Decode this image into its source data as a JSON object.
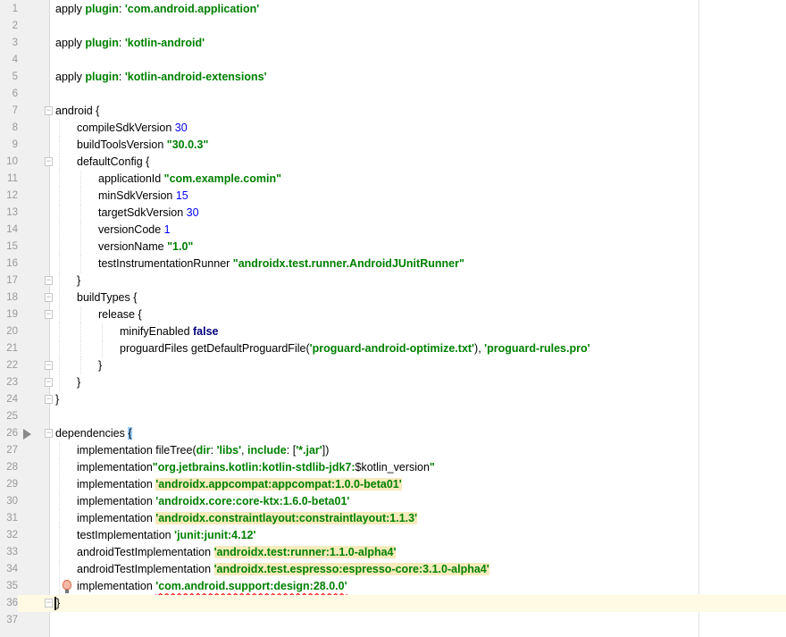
{
  "editor": {
    "current_line": 36,
    "lines": [
      {
        "n": "1",
        "indent": 0,
        "tokens": [
          {
            "t": "apply ",
            "c": "plain"
          },
          {
            "t": "plugin",
            "c": "named"
          },
          {
            "t": ": ",
            "c": "plain"
          },
          {
            "t": "'com.android.application'",
            "c": "str"
          }
        ]
      },
      {
        "n": "2",
        "indent": 0,
        "tokens": []
      },
      {
        "n": "3",
        "indent": 0,
        "tokens": [
          {
            "t": "apply ",
            "c": "plain"
          },
          {
            "t": "plugin",
            "c": "named"
          },
          {
            "t": ": ",
            "c": "plain"
          },
          {
            "t": "'kotlin-android'",
            "c": "str"
          }
        ]
      },
      {
        "n": "4",
        "indent": 0,
        "tokens": []
      },
      {
        "n": "5",
        "indent": 0,
        "tokens": [
          {
            "t": "apply ",
            "c": "plain"
          },
          {
            "t": "plugin",
            "c": "named"
          },
          {
            "t": ": ",
            "c": "plain"
          },
          {
            "t": "'kotlin-android-extensions'",
            "c": "str"
          }
        ]
      },
      {
        "n": "6",
        "indent": 0,
        "tokens": []
      },
      {
        "n": "7",
        "indent": 0,
        "fold": true,
        "tokens": [
          {
            "t": "android {",
            "c": "plain"
          }
        ]
      },
      {
        "n": "8",
        "indent": 1,
        "tokens": [
          {
            "t": "compileSdkVersion ",
            "c": "plain"
          },
          {
            "t": "30",
            "c": "num"
          }
        ]
      },
      {
        "n": "9",
        "indent": 1,
        "tokens": [
          {
            "t": "buildToolsVersion ",
            "c": "plain"
          },
          {
            "t": "\"30.0.3\"",
            "c": "str"
          }
        ]
      },
      {
        "n": "10",
        "indent": 1,
        "fold": true,
        "tokens": [
          {
            "t": "defaultConfig {",
            "c": "plain"
          }
        ]
      },
      {
        "n": "11",
        "indent": 2,
        "tokens": [
          {
            "t": "applicationId ",
            "c": "plain"
          },
          {
            "t": "\"com.example.comin\"",
            "c": "str"
          }
        ]
      },
      {
        "n": "12",
        "indent": 2,
        "tokens": [
          {
            "t": "minSdkVersion ",
            "c": "plain"
          },
          {
            "t": "15",
            "c": "num"
          }
        ]
      },
      {
        "n": "13",
        "indent": 2,
        "tokens": [
          {
            "t": "targetSdkVersion ",
            "c": "plain"
          },
          {
            "t": "30",
            "c": "num"
          }
        ]
      },
      {
        "n": "14",
        "indent": 2,
        "tokens": [
          {
            "t": "versionCode ",
            "c": "plain"
          },
          {
            "t": "1",
            "c": "num"
          }
        ]
      },
      {
        "n": "15",
        "indent": 2,
        "tokens": [
          {
            "t": "versionName ",
            "c": "plain"
          },
          {
            "t": "\"1.0\"",
            "c": "str"
          }
        ]
      },
      {
        "n": "16",
        "indent": 2,
        "tokens": [
          {
            "t": "testInstrumentationRunner ",
            "c": "plain"
          },
          {
            "t": "\"androidx.test.runner.AndroidJUnitRunner\"",
            "c": "str"
          }
        ]
      },
      {
        "n": "17",
        "indent": 1,
        "fold": true,
        "tokens": [
          {
            "t": "}",
            "c": "plain"
          }
        ]
      },
      {
        "n": "18",
        "indent": 1,
        "fold": true,
        "tokens": [
          {
            "t": "buildTypes {",
            "c": "plain"
          }
        ]
      },
      {
        "n": "19",
        "indent": 2,
        "fold": true,
        "tokens": [
          {
            "t": "release {",
            "c": "plain"
          }
        ]
      },
      {
        "n": "20",
        "indent": 3,
        "tokens": [
          {
            "t": "minifyEnabled ",
            "c": "plain"
          },
          {
            "t": "false",
            "c": "kw"
          }
        ]
      },
      {
        "n": "21",
        "indent": 3,
        "tokens": [
          {
            "t": "proguardFiles getDefaultProguardFile(",
            "c": "plain"
          },
          {
            "t": "'proguard-android-optimize.txt'",
            "c": "str"
          },
          {
            "t": "), ",
            "c": "plain"
          },
          {
            "t": "'proguard-rules.pro'",
            "c": "str"
          }
        ]
      },
      {
        "n": "22",
        "indent": 2,
        "fold": true,
        "tokens": [
          {
            "t": "}",
            "c": "plain"
          }
        ]
      },
      {
        "n": "23",
        "indent": 1,
        "fold": true,
        "tokens": [
          {
            "t": "}",
            "c": "plain"
          }
        ]
      },
      {
        "n": "24",
        "indent": 0,
        "fold": true,
        "tokens": [
          {
            "t": "}",
            "c": "plain"
          }
        ]
      },
      {
        "n": "25",
        "indent": 0,
        "tokens": []
      },
      {
        "n": "26",
        "indent": 0,
        "fold": true,
        "run": true,
        "tokens": [
          {
            "t": "dependencies ",
            "c": "plain"
          },
          {
            "t": "{",
            "c": "plain brace"
          }
        ]
      },
      {
        "n": "27",
        "indent": 1,
        "tokens": [
          {
            "t": "implementation fileTree(",
            "c": "plain"
          },
          {
            "t": "dir",
            "c": "named"
          },
          {
            "t": ": ",
            "c": "plain"
          },
          {
            "t": "'libs'",
            "c": "str"
          },
          {
            "t": ", ",
            "c": "plain"
          },
          {
            "t": "include",
            "c": "named"
          },
          {
            "t": ": [",
            "c": "plain"
          },
          {
            "t": "'*.jar'",
            "c": "str"
          },
          {
            "t": "])",
            "c": "plain"
          }
        ]
      },
      {
        "n": "28",
        "indent": 1,
        "tokens": [
          {
            "t": "implementation",
            "c": "plain"
          },
          {
            "t": "\"org.jetbrains.kotlin:kotlin-stdlib-jdk7:",
            "c": "str"
          },
          {
            "t": "$kotlin_version",
            "c": "plain"
          },
          {
            "t": "\"",
            "c": "str"
          }
        ]
      },
      {
        "n": "29",
        "indent": 1,
        "tokens": [
          {
            "t": "implementation ",
            "c": "plain"
          },
          {
            "t": "'androidx.appcompat:appcompat:1.0.0-beta01'",
            "c": "str hl"
          }
        ]
      },
      {
        "n": "30",
        "indent": 1,
        "tokens": [
          {
            "t": "implementation ",
            "c": "plain"
          },
          {
            "t": "'androidx.core:core-ktx:1.6.0-beta01'",
            "c": "str"
          }
        ]
      },
      {
        "n": "31",
        "indent": 1,
        "tokens": [
          {
            "t": "implementation ",
            "c": "plain"
          },
          {
            "t": "'androidx.constraintlayout:constraintlayout:1.1.3'",
            "c": "str hl"
          }
        ]
      },
      {
        "n": "32",
        "indent": 1,
        "tokens": [
          {
            "t": "testImplementation ",
            "c": "plain"
          },
          {
            "t": "'junit:junit:4.12'",
            "c": "str"
          }
        ]
      },
      {
        "n": "33",
        "indent": 1,
        "tokens": [
          {
            "t": "androidTestImplementation ",
            "c": "plain"
          },
          {
            "t": "'androidx.test:runner:1.1.0-alpha4'",
            "c": "str hl"
          }
        ]
      },
      {
        "n": "34",
        "indent": 1,
        "tokens": [
          {
            "t": "androidTestImplementation ",
            "c": "plain"
          },
          {
            "t": "'androidx.test.espresso:espresso-core:3.1.0-alpha4'",
            "c": "str hl"
          }
        ]
      },
      {
        "n": "35",
        "indent": 1,
        "bulb": true,
        "tokens": [
          {
            "t": "implementation ",
            "c": "plain"
          },
          {
            "t": "'com.android.support:design:28.0.0'",
            "c": "str err"
          }
        ]
      },
      {
        "n": "36",
        "indent": 0,
        "fold": true,
        "caret": true,
        "tokens": [
          {
            "t": "}",
            "c": "plain"
          }
        ]
      },
      {
        "n": "37",
        "indent": 0,
        "tokens": []
      }
    ]
  },
  "colors": {
    "string": "#008000",
    "number": "#0000ff",
    "keyword": "#000080",
    "highlight": "#f6ebbc",
    "current_line": "#fffae3"
  }
}
